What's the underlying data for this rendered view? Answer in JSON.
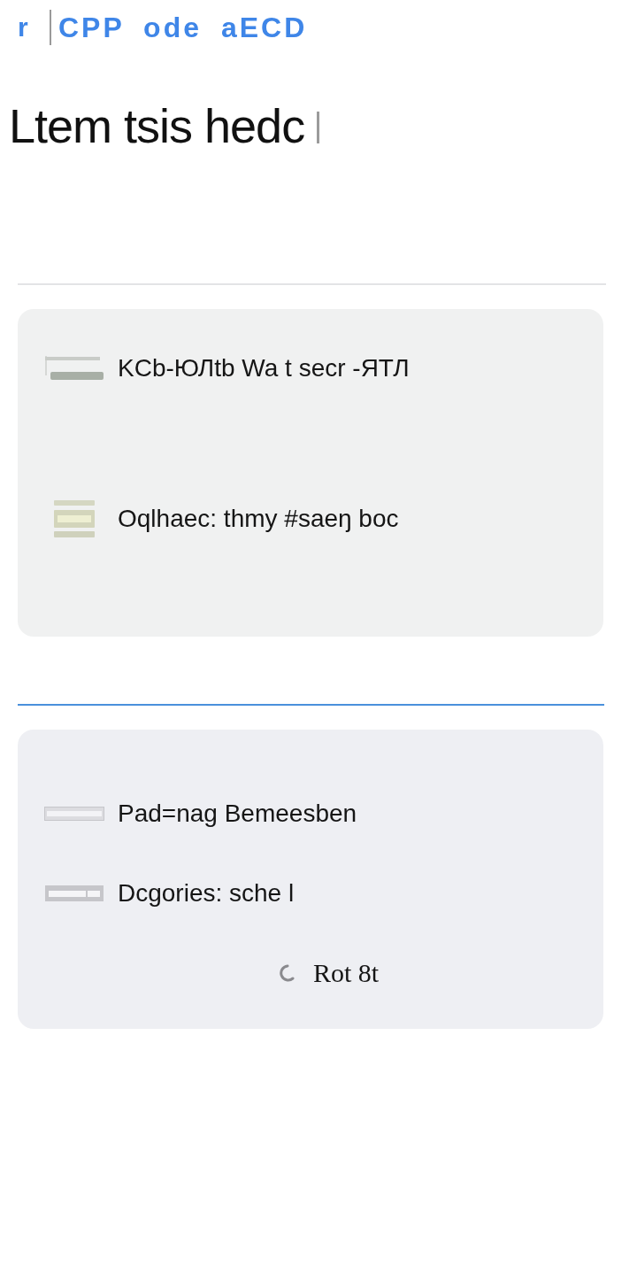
{
  "header": {
    "mark": "r",
    "title": "CPP ode aECD"
  },
  "heading": "Ltem tsis hedc",
  "cards": [
    {
      "rows": [
        {
          "kind": "double-bar",
          "label": "KCb-ЮЛtb Wa t secr -ЯТЛ"
        },
        {
          "kind": "stack",
          "label": "Oqlhaec: thmy #saeŋ boc"
        }
      ]
    },
    {
      "rows": [
        {
          "kind": "outline-bar",
          "label": "Pad=nag Bemeesben"
        },
        {
          "kind": "split-bar",
          "label": "Dcgories: sche l"
        }
      ],
      "footer": {
        "label": "Rot 8t"
      }
    }
  ]
}
